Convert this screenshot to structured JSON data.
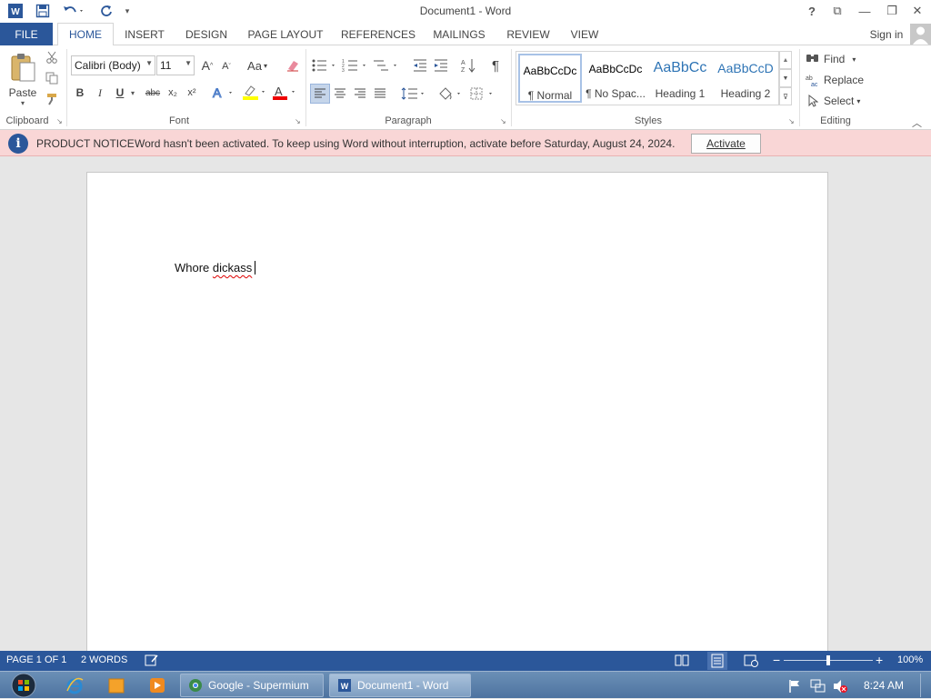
{
  "window": {
    "title": "Document1 - Word",
    "controls": {
      "help": "?",
      "ribbon_display": "⧉",
      "minimize": "—",
      "restore": "❐",
      "close": "✕"
    }
  },
  "tabs": {
    "file": "FILE",
    "items": [
      "HOME",
      "INSERT",
      "DESIGN",
      "PAGE LAYOUT",
      "REFERENCES",
      "MAILINGS",
      "REVIEW",
      "VIEW"
    ],
    "sign_in": "Sign in"
  },
  "ribbon": {
    "clipboard": {
      "label": "Clipboard",
      "paste": "Paste"
    },
    "font": {
      "label": "Font",
      "font_name": "Calibri (Body)",
      "font_size": "11",
      "bold": "B",
      "italic": "I",
      "underline": "U",
      "strike": "abc",
      "subscript": "x₂",
      "superscript": "x²",
      "change_case": "Aa",
      "grow": "A",
      "shrink": "A"
    },
    "paragraph": {
      "label": "Paragraph",
      "pilcrow": "¶"
    },
    "styles": {
      "label": "Styles",
      "items": [
        {
          "preview": "AaBbCcDc",
          "name": "¶ Normal"
        },
        {
          "preview": "AaBbCcDc",
          "name": "¶ No Spac..."
        },
        {
          "preview": "AaBbCc",
          "name": "Heading 1"
        },
        {
          "preview": "AaBbCcD",
          "name": "Heading 2"
        }
      ]
    },
    "editing": {
      "label": "Editing",
      "find": "Find",
      "replace": "Replace",
      "select": "Select"
    }
  },
  "notice": {
    "label": "PRODUCT NOTICE",
    "message": "Word hasn't been activated. To keep using Word without interruption, activate before Saturday, August 24, 2024.",
    "button": "Activate"
  },
  "document": {
    "word1": "Whore",
    "word2": "dickass"
  },
  "statusbar": {
    "page": "PAGE 1 OF 1",
    "words": "2 WORDS",
    "zoom": "100%"
  },
  "taskbar": {
    "apps": [
      "Google - Supermium",
      "Document1 - Word"
    ],
    "clock": "8:24 AM"
  },
  "colors": {
    "accent": "#2b579a",
    "notice_bg": "#f9d6d6"
  }
}
